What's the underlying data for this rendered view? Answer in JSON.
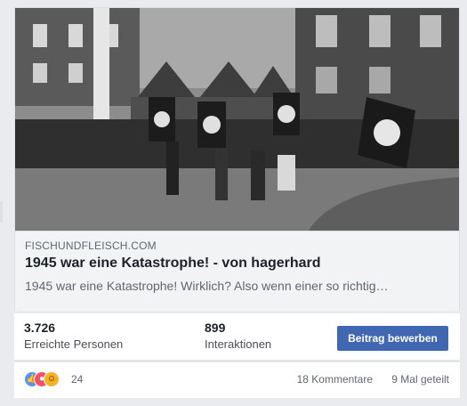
{
  "link": {
    "domain": "FISCHUNDFLEISCH.COM",
    "title": "1945 war eine Katastrophe! - von hagerhard",
    "description": "1945 war eine Katastrophe! Wirklich? Also wenn einer so richtig…"
  },
  "stats": {
    "reach_value": "3.726",
    "reach_label": "Erreichte Personen",
    "interactions_value": "899",
    "interactions_label": "Interaktionen",
    "boost_label": "Beitrag bewerben"
  },
  "reactions": {
    "icons": [
      "like-icon",
      "angry-icon",
      "haha-icon"
    ],
    "count": "24",
    "comments": "18 Kommentare",
    "shares": "9 Mal geteilt"
  },
  "colors": {
    "accent": "#4267b2",
    "like": "#5890ff",
    "angry": "#f25268",
    "haha": "#f7b125"
  }
}
